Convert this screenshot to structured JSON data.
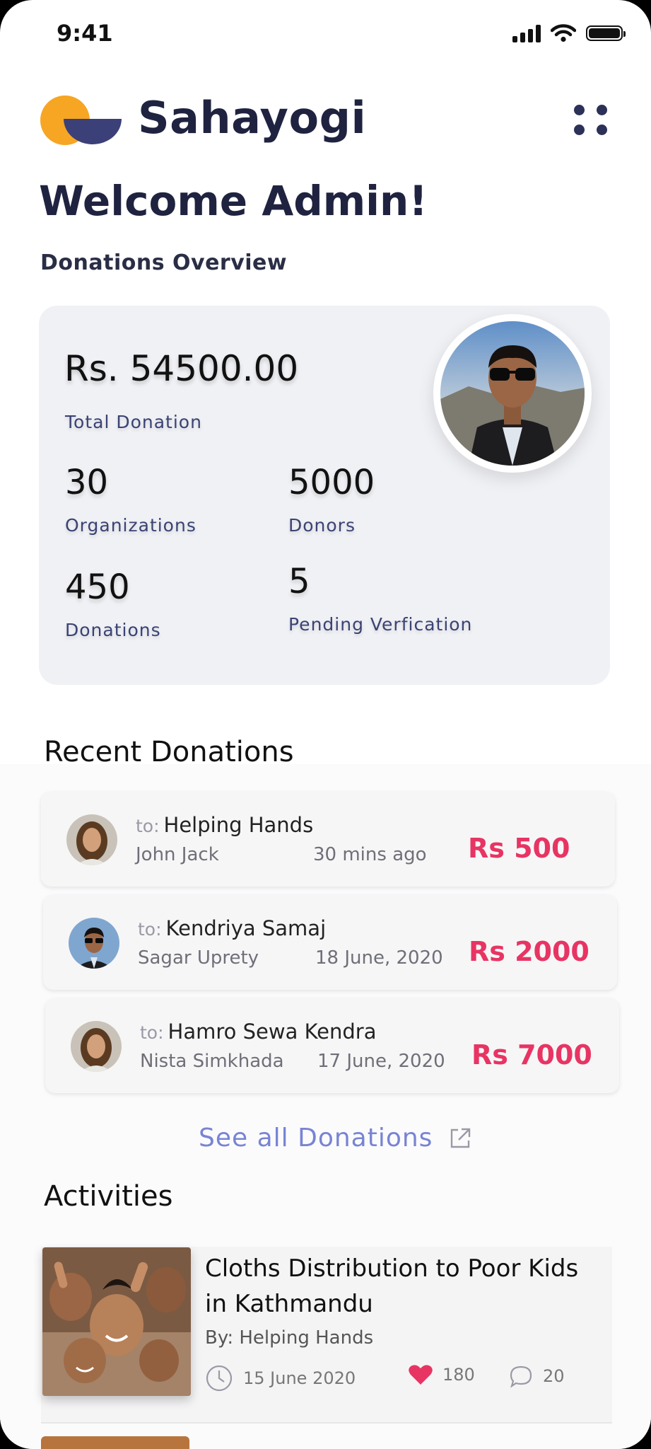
{
  "status_bar": {
    "time": "9:41"
  },
  "app": {
    "name": "Sahayogi"
  },
  "header": {
    "welcome": "Welcome Admin!",
    "overview_label": "Donations Overview"
  },
  "overview": {
    "total_amount": "Rs. 54500.00",
    "total_label": "Total Donation",
    "stats": [
      {
        "value": "30",
        "label": "Organizations"
      },
      {
        "value": "5000",
        "label": "Donors"
      },
      {
        "value": "450",
        "label": "Donations"
      },
      {
        "value": "5",
        "label": "Pending Verfication"
      }
    ]
  },
  "recent": {
    "title": "Recent Donations",
    "to_prefix": "to:",
    "items": [
      {
        "to": "Helping Hands",
        "donor": "John Jack",
        "time": "30 mins ago",
        "amount": "Rs 500"
      },
      {
        "to": "Kendriya Samaj",
        "donor": "Sagar Uprety",
        "time": "18 June, 2020",
        "amount": "Rs 2000"
      },
      {
        "to": "Hamro Sewa Kendra",
        "donor": "Nista Simkhada",
        "time": "17 June, 2020",
        "amount": "Rs 7000"
      }
    ],
    "see_all": "See all Donations"
  },
  "activities": {
    "title": "Activities",
    "items": [
      {
        "title": "Cloths Distribution to Poor Kids in Kathmandu",
        "by": "By: Helping Hands",
        "date": "15 June 2020",
        "likes": "180",
        "comments": "20"
      }
    ]
  },
  "colors": {
    "accent_pink": "#e83463",
    "link_blue": "#7884d3",
    "navy": "#1f2340",
    "logo_orange": "#f6a623",
    "logo_navy": "#3c4078"
  }
}
